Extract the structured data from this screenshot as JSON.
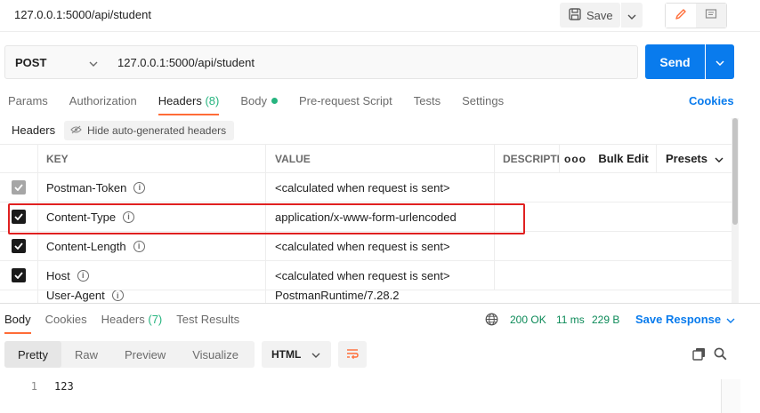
{
  "request": {
    "title": "127.0.0.1:5000/api/student",
    "save_label": "Save",
    "method": "POST",
    "url": "127.0.0.1:5000/api/student",
    "send_label": "Send"
  },
  "request_tabs": [
    {
      "label": "Params",
      "count": ""
    },
    {
      "label": "Authorization",
      "count": ""
    },
    {
      "label": "Headers",
      "count": "(8)"
    },
    {
      "label": "Body",
      "count": ""
    },
    {
      "label": "Pre-request Script",
      "count": ""
    },
    {
      "label": "Tests",
      "count": ""
    },
    {
      "label": "Settings",
      "count": ""
    }
  ],
  "cookies_label": "Cookies",
  "headers_section": {
    "label": "Headers",
    "hide_auto_label": "Hide auto-generated headers"
  },
  "table": {
    "col_key": "KEY",
    "col_value": "VALUE",
    "col_description": "DESCRIPTION",
    "more_label": "ooo",
    "bulk_edit_label": "Bulk Edit",
    "presets_label": "Presets",
    "rows": [
      {
        "key": "Postman-Token",
        "value": "<calculated when request is sent>"
      },
      {
        "key": "Content-Type",
        "value": "application/x-www-form-urlencoded"
      },
      {
        "key": "Content-Length",
        "value": "<calculated when request is sent>"
      },
      {
        "key": "Host",
        "value": "<calculated when request is sent>"
      },
      {
        "key": "User-Agent",
        "value": "PostmanRuntime/7.28.2"
      }
    ]
  },
  "response_tabs": [
    {
      "label": "Body",
      "count": ""
    },
    {
      "label": "Cookies",
      "count": ""
    },
    {
      "label": "Headers",
      "count": "(7)"
    },
    {
      "label": "Test Results",
      "count": ""
    }
  ],
  "response_meta": {
    "status": "200 OK",
    "time": "11 ms",
    "size": "229 B",
    "save_response_label": "Save Response"
  },
  "view_tabs": [
    "Pretty",
    "Raw",
    "Preview",
    "Visualize"
  ],
  "format_select": "HTML",
  "body": {
    "line_number": "1",
    "content": "123"
  },
  "colors": {
    "accent_orange": "#ff6c37",
    "primary_blue": "#097bed",
    "success_green": "#26b47f",
    "highlight_red": "#e02020"
  },
  "icons": {
    "save": "save-disk-icon",
    "chevron": "chevron-down-icon",
    "edit": "pencil-icon",
    "comment": "comment-icon",
    "info": "info-icon",
    "check": "checkbox-icon",
    "globe": "globe-icon",
    "wrap": "wrap-lines-icon",
    "copy": "copy-icon",
    "search": "search-icon"
  }
}
